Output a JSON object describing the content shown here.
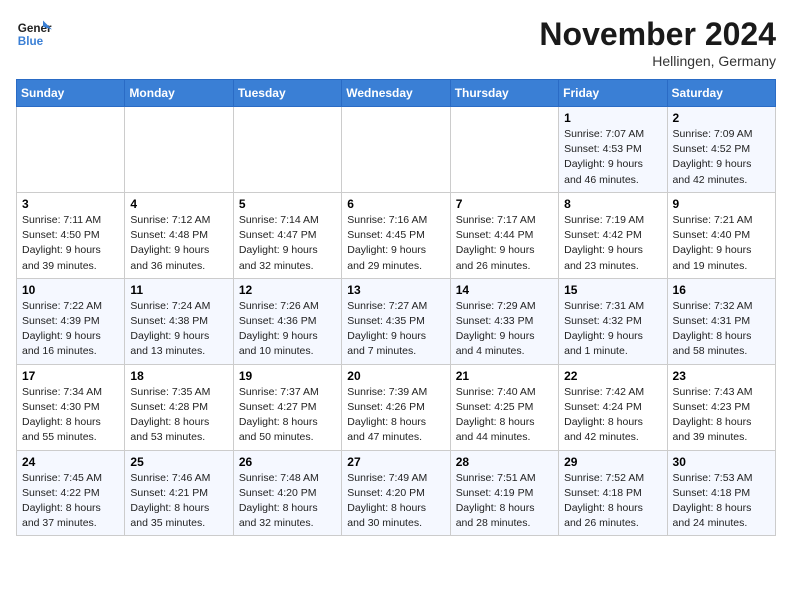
{
  "header": {
    "logo_line1": "General",
    "logo_line2": "Blue",
    "month_title": "November 2024",
    "location": "Hellingen, Germany"
  },
  "days_of_week": [
    "Sunday",
    "Monday",
    "Tuesday",
    "Wednesday",
    "Thursday",
    "Friday",
    "Saturday"
  ],
  "weeks": [
    {
      "days": [
        {
          "num": "",
          "info": ""
        },
        {
          "num": "",
          "info": ""
        },
        {
          "num": "",
          "info": ""
        },
        {
          "num": "",
          "info": ""
        },
        {
          "num": "",
          "info": ""
        },
        {
          "num": "1",
          "info": "Sunrise: 7:07 AM\nSunset: 4:53 PM\nDaylight: 9 hours\nand 46 minutes."
        },
        {
          "num": "2",
          "info": "Sunrise: 7:09 AM\nSunset: 4:52 PM\nDaylight: 9 hours\nand 42 minutes."
        }
      ]
    },
    {
      "days": [
        {
          "num": "3",
          "info": "Sunrise: 7:11 AM\nSunset: 4:50 PM\nDaylight: 9 hours\nand 39 minutes."
        },
        {
          "num": "4",
          "info": "Sunrise: 7:12 AM\nSunset: 4:48 PM\nDaylight: 9 hours\nand 36 minutes."
        },
        {
          "num": "5",
          "info": "Sunrise: 7:14 AM\nSunset: 4:47 PM\nDaylight: 9 hours\nand 32 minutes."
        },
        {
          "num": "6",
          "info": "Sunrise: 7:16 AM\nSunset: 4:45 PM\nDaylight: 9 hours\nand 29 minutes."
        },
        {
          "num": "7",
          "info": "Sunrise: 7:17 AM\nSunset: 4:44 PM\nDaylight: 9 hours\nand 26 minutes."
        },
        {
          "num": "8",
          "info": "Sunrise: 7:19 AM\nSunset: 4:42 PM\nDaylight: 9 hours\nand 23 minutes."
        },
        {
          "num": "9",
          "info": "Sunrise: 7:21 AM\nSunset: 4:40 PM\nDaylight: 9 hours\nand 19 minutes."
        }
      ]
    },
    {
      "days": [
        {
          "num": "10",
          "info": "Sunrise: 7:22 AM\nSunset: 4:39 PM\nDaylight: 9 hours\nand 16 minutes."
        },
        {
          "num": "11",
          "info": "Sunrise: 7:24 AM\nSunset: 4:38 PM\nDaylight: 9 hours\nand 13 minutes."
        },
        {
          "num": "12",
          "info": "Sunrise: 7:26 AM\nSunset: 4:36 PM\nDaylight: 9 hours\nand 10 minutes."
        },
        {
          "num": "13",
          "info": "Sunrise: 7:27 AM\nSunset: 4:35 PM\nDaylight: 9 hours\nand 7 minutes."
        },
        {
          "num": "14",
          "info": "Sunrise: 7:29 AM\nSunset: 4:33 PM\nDaylight: 9 hours\nand 4 minutes."
        },
        {
          "num": "15",
          "info": "Sunrise: 7:31 AM\nSunset: 4:32 PM\nDaylight: 9 hours\nand 1 minute."
        },
        {
          "num": "16",
          "info": "Sunrise: 7:32 AM\nSunset: 4:31 PM\nDaylight: 8 hours\nand 58 minutes."
        }
      ]
    },
    {
      "days": [
        {
          "num": "17",
          "info": "Sunrise: 7:34 AM\nSunset: 4:30 PM\nDaylight: 8 hours\nand 55 minutes."
        },
        {
          "num": "18",
          "info": "Sunrise: 7:35 AM\nSunset: 4:28 PM\nDaylight: 8 hours\nand 53 minutes."
        },
        {
          "num": "19",
          "info": "Sunrise: 7:37 AM\nSunset: 4:27 PM\nDaylight: 8 hours\nand 50 minutes."
        },
        {
          "num": "20",
          "info": "Sunrise: 7:39 AM\nSunset: 4:26 PM\nDaylight: 8 hours\nand 47 minutes."
        },
        {
          "num": "21",
          "info": "Sunrise: 7:40 AM\nSunset: 4:25 PM\nDaylight: 8 hours\nand 44 minutes."
        },
        {
          "num": "22",
          "info": "Sunrise: 7:42 AM\nSunset: 4:24 PM\nDaylight: 8 hours\nand 42 minutes."
        },
        {
          "num": "23",
          "info": "Sunrise: 7:43 AM\nSunset: 4:23 PM\nDaylight: 8 hours\nand 39 minutes."
        }
      ]
    },
    {
      "days": [
        {
          "num": "24",
          "info": "Sunrise: 7:45 AM\nSunset: 4:22 PM\nDaylight: 8 hours\nand 37 minutes."
        },
        {
          "num": "25",
          "info": "Sunrise: 7:46 AM\nSunset: 4:21 PM\nDaylight: 8 hours\nand 35 minutes."
        },
        {
          "num": "26",
          "info": "Sunrise: 7:48 AM\nSunset: 4:20 PM\nDaylight: 8 hours\nand 32 minutes."
        },
        {
          "num": "27",
          "info": "Sunrise: 7:49 AM\nSunset: 4:20 PM\nDaylight: 8 hours\nand 30 minutes."
        },
        {
          "num": "28",
          "info": "Sunrise: 7:51 AM\nSunset: 4:19 PM\nDaylight: 8 hours\nand 28 minutes."
        },
        {
          "num": "29",
          "info": "Sunrise: 7:52 AM\nSunset: 4:18 PM\nDaylight: 8 hours\nand 26 minutes."
        },
        {
          "num": "30",
          "info": "Sunrise: 7:53 AM\nSunset: 4:18 PM\nDaylight: 8 hours\nand 24 minutes."
        }
      ]
    }
  ]
}
